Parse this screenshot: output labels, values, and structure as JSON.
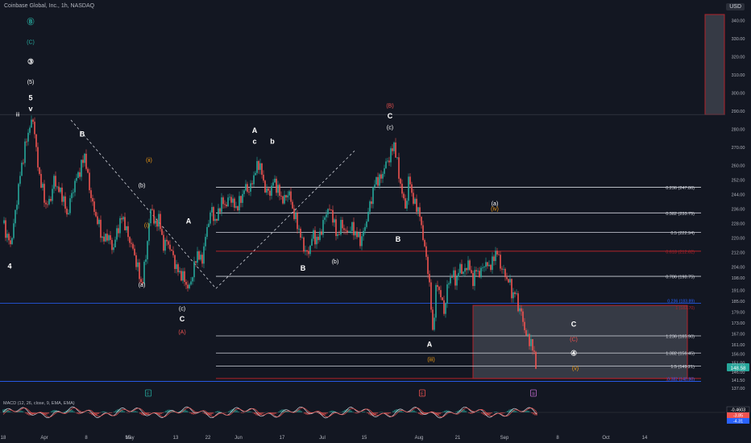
{
  "header": {
    "title": "Coinbase Global, Inc., 1h, NASDAQ",
    "currency": "USD"
  },
  "colors": {
    "background": "#131722",
    "up": "#26a69a",
    "down": "#ef5350",
    "fib": "#d1d4dc",
    "red_level": "#b2232a",
    "blue_level": "#2962ff",
    "orange": "#f39c12",
    "teal": "#26a69a",
    "purple": "#ba68c8",
    "macd_line": "#d1d4dc",
    "signal_line": "#ef5350"
  },
  "chart_data": {
    "type": "candlestick",
    "symbol": "Coinbase Global, Inc.",
    "interval": "1h",
    "exchange": "NASDAQ",
    "ylim": [
      137,
      345
    ],
    "y_ticks": [
      137,
      141.5,
      146,
      151,
      156,
      161,
      167,
      173,
      179,
      185,
      191,
      198,
      204,
      212,
      220,
      228,
      236,
      244,
      252,
      260,
      270,
      280,
      290,
      300,
      310,
      320,
      330,
      340
    ],
    "x_tick_labels": [
      "18",
      "Apr",
      "8",
      "15",
      "May",
      "13",
      "22",
      "Jun",
      "17",
      "Jul",
      "15",
      "Aug",
      "21",
      "Sep",
      "8",
      "Oct",
      "14"
    ],
    "price_path": [
      [
        0,
        228
      ],
      [
        4,
        222
      ],
      [
        9,
        216
      ],
      [
        14,
        230
      ],
      [
        20,
        252
      ],
      [
        27,
        270
      ],
      [
        33,
        282
      ],
      [
        38,
        285
      ],
      [
        42,
        262
      ],
      [
        47,
        250
      ],
      [
        53,
        238
      ],
      [
        58,
        240
      ],
      [
        63,
        252
      ],
      [
        69,
        246
      ],
      [
        74,
        243
      ],
      [
        79,
        232
      ],
      [
        85,
        244
      ],
      [
        90,
        252
      ],
      [
        96,
        258
      ],
      [
        101,
        266
      ],
      [
        106,
        250
      ],
      [
        112,
        236
      ],
      [
        118,
        228
      ],
      [
        124,
        218
      ],
      [
        130,
        222
      ],
      [
        136,
        213
      ],
      [
        142,
        225
      ],
      [
        148,
        232
      ],
      [
        154,
        222
      ],
      [
        160,
        215
      ],
      [
        166,
        205
      ],
      [
        172,
        193
      ],
      [
        178,
        214
      ],
      [
        184,
        240
      ],
      [
        188,
        225
      ],
      [
        193,
        232
      ],
      [
        198,
        216
      ],
      [
        204,
        218
      ],
      [
        209,
        212
      ],
      [
        215,
        203
      ],
      [
        220,
        200
      ],
      [
        225,
        197
      ],
      [
        230,
        191
      ],
      [
        236,
        202
      ],
      [
        241,
        212
      ],
      [
        246,
        206
      ],
      [
        252,
        223
      ],
      [
        258,
        236
      ],
      [
        264,
        228
      ],
      [
        270,
        240
      ],
      [
        276,
        238
      ],
      [
        282,
        243
      ],
      [
        288,
        236
      ],
      [
        294,
        240
      ],
      [
        300,
        248
      ],
      [
        306,
        246
      ],
      [
        312,
        256
      ],
      [
        318,
        262
      ],
      [
        324,
        248
      ],
      [
        330,
        244
      ],
      [
        336,
        252
      ],
      [
        342,
        245
      ],
      [
        348,
        240
      ],
      [
        354,
        246
      ],
      [
        360,
        234
      ],
      [
        366,
        226
      ],
      [
        372,
        216
      ],
      [
        378,
        210
      ],
      [
        384,
        222
      ],
      [
        390,
        218
      ],
      [
        396,
        226
      ],
      [
        402,
        236
      ],
      [
        408,
        234
      ],
      [
        414,
        220
      ],
      [
        420,
        228
      ],
      [
        426,
        222
      ],
      [
        432,
        226
      ],
      [
        438,
        222
      ],
      [
        444,
        218
      ],
      [
        450,
        228
      ],
      [
        456,
        240
      ],
      [
        462,
        252
      ],
      [
        468,
        252
      ],
      [
        474,
        260
      ],
      [
        480,
        265
      ],
      [
        485,
        272
      ],
      [
        490,
        258
      ],
      [
        495,
        244
      ],
      [
        500,
        236
      ],
      [
        504,
        256
      ],
      [
        508,
        240
      ],
      [
        513,
        238
      ],
      [
        518,
        230
      ],
      [
        523,
        214
      ],
      [
        528,
        200
      ],
      [
        533,
        168
      ],
      [
        538,
        196
      ],
      [
        543,
        188
      ],
      [
        547,
        179
      ],
      [
        552,
        195
      ],
      [
        557,
        200
      ],
      [
        562,
        196
      ],
      [
        567,
        204
      ],
      [
        572,
        200
      ],
      [
        577,
        207
      ],
      [
        582,
        196
      ],
      [
        587,
        202
      ],
      [
        592,
        200
      ],
      [
        597,
        206
      ],
      [
        602,
        204
      ],
      [
        607,
        206
      ],
      [
        612,
        214
      ],
      [
        616,
        206
      ],
      [
        620,
        202
      ],
      [
        624,
        198
      ],
      [
        628,
        196
      ],
      [
        632,
        188
      ],
      [
        636,
        190
      ],
      [
        640,
        180
      ],
      [
        644,
        178
      ],
      [
        648,
        166
      ],
      [
        652,
        165
      ],
      [
        656,
        160
      ],
      [
        660,
        155
      ],
      [
        662,
        145.5
      ]
    ],
    "fibonacci_levels": [
      {
        "label": "0.236 (247.86)",
        "value": 247.86
      },
      {
        "label": "0.382 (233.75)",
        "value": 233.75
      },
      {
        "label": "0.5 (222.94)",
        "value": 222.94
      },
      {
        "label": "0.618 (212.62)",
        "value": 212.62
      },
      {
        "label": "0.786 (198.75)",
        "value": 198.75
      },
      {
        "label": "1.236 (165.90)",
        "value": 165.9
      },
      {
        "label": "1.382 (156.45)",
        "value": 156.45
      },
      {
        "label": "1.5 (149.21)",
        "value": 149.21
      },
      {
        "label": "1.618 (142.37)",
        "value": 142.37
      }
    ],
    "blue_levels": [
      {
        "label": "0.236 (183.89)",
        "value": 183.89
      },
      {
        "label": "0.382 (140.80)",
        "value": 140.8
      }
    ],
    "red_level_box": {
      "label": "1 (182.70)",
      "value": 182.7
    },
    "target_box": {
      "from": 142.37,
      "to": 182.7
    },
    "upper_box": {
      "from": 288,
      "to": 345
    },
    "current_price": "148.58",
    "wave_labels": [
      {
        "text": "Ⓑ",
        "color": "#26a69a",
        "price": 338
      },
      {
        "text": "(C)",
        "color": "#26a69a",
        "price": 327
      },
      {
        "text": "③",
        "color": "#ffffff",
        "price": 316
      },
      {
        "text": "(5)",
        "color": "#ffffff",
        "price": 305
      },
      {
        "text": "5",
        "color": "#ffffff",
        "price": 296
      },
      {
        "text": "v",
        "color": "#ffffff",
        "price": 290
      },
      {
        "text": "iii",
        "color": "#ffffff",
        "price": 287
      },
      {
        "text": "(B)",
        "color": "#ef5350",
        "price": 292
      },
      {
        "text": "C",
        "color": "#ffffff",
        "price": 286
      },
      {
        "text": "(c)",
        "color": "#ffffff",
        "price": 280
      },
      {
        "text": "A",
        "color": "#ffffff",
        "price": 278
      },
      {
        "text": "c",
        "color": "#ffffff",
        "price": 272
      },
      {
        "text": "b",
        "color": "#ffffff",
        "price": 272
      },
      {
        "text": "B",
        "color": "#ffffff",
        "price": 276
      },
      {
        "text": "(ii)",
        "color": "#f39c12",
        "price": 262
      },
      {
        "text": "(b)",
        "color": "#ffffff",
        "price": 248
      },
      {
        "text": "(a)",
        "color": "#ffffff",
        "price": 238
      },
      {
        "text": "(iv)",
        "color": "#f39c12",
        "price": 235
      },
      {
        "text": "B",
        "color": "#ffffff",
        "price": 218
      },
      {
        "text": "(i)",
        "color": "#f39c12",
        "price": 226
      },
      {
        "text": "(b)",
        "color": "#ffffff",
        "price": 206
      },
      {
        "text": "B",
        "color": "#ffffff",
        "price": 202
      },
      {
        "text": "A",
        "color": "#ffffff",
        "price": 228
      },
      {
        "text": "(a)",
        "color": "#ffffff",
        "price": 193
      },
      {
        "text": "(c)",
        "color": "#ffffff",
        "price": 180
      },
      {
        "text": "C",
        "color": "#ffffff",
        "price": 174
      },
      {
        "text": "(A)",
        "color": "#ef5350",
        "price": 167
      },
      {
        "text": "4",
        "color": "#ffffff",
        "price": 203
      },
      {
        "text": "A",
        "color": "#ffffff",
        "price": 160
      },
      {
        "text": "(iii)",
        "color": "#f39c12",
        "price": 152
      },
      {
        "text": "C",
        "color": "#ffffff",
        "price": 171
      },
      {
        "text": "(C)",
        "color": "#ef5350",
        "price": 163
      },
      {
        "text": "④",
        "color": "#ffffff",
        "price": 155
      },
      {
        "text": "(v)",
        "color": "#f39c12",
        "price": 147
      }
    ],
    "macd": {
      "label": "MACD (12, 26, close, 9, EMA, EMA)",
      "values": [
        {
          "value": "-0.4603",
          "color": "#e0e3eb"
        },
        {
          "value": "-3.85",
          "color": "#ef5350"
        },
        {
          "value": "-4.31",
          "color": "#2962ff"
        }
      ]
    },
    "bottom_markers": [
      {
        "text": "E",
        "color": "#26a69a"
      },
      {
        "text": "E",
        "color": "#ef5350"
      },
      {
        "text": "⑤",
        "color": "#ba68c8"
      }
    ],
    "grid": false
  }
}
